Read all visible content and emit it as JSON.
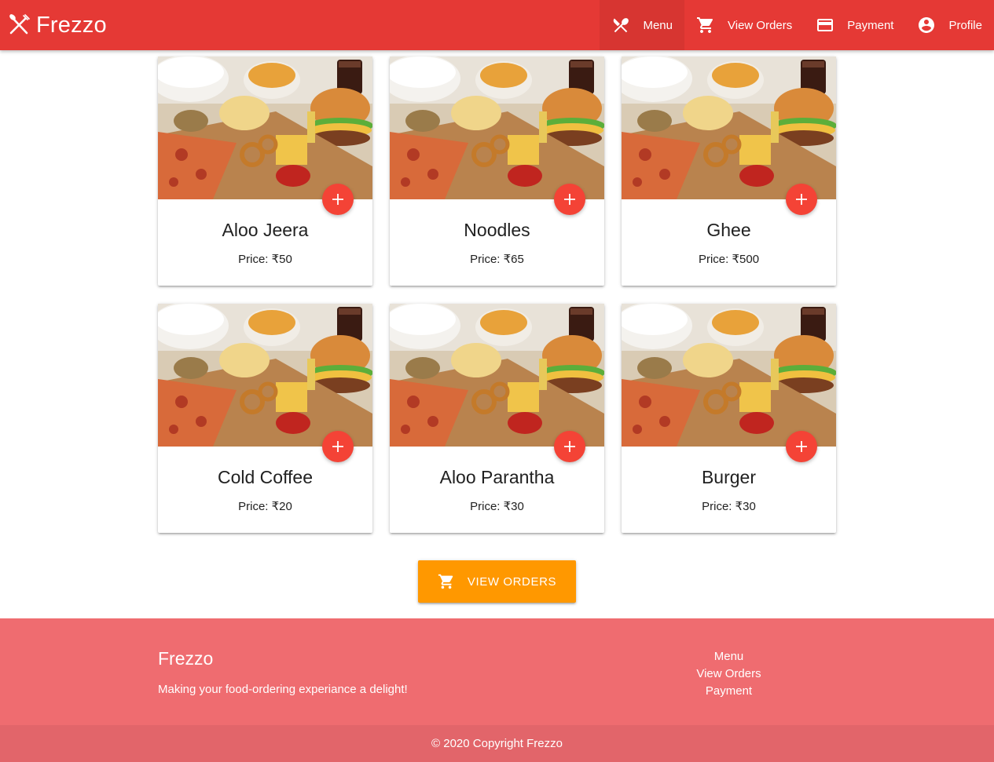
{
  "navbar": {
    "brand": "Frezzo",
    "items": [
      {
        "label": "Menu",
        "icon": "fork-knife-icon",
        "active": true
      },
      {
        "label": "View Orders",
        "icon": "cart-icon"
      },
      {
        "label": "Payment",
        "icon": "credit-card-icon"
      },
      {
        "label": "Profile",
        "icon": "account-circle-icon"
      }
    ]
  },
  "menu": {
    "items": [
      {
        "name": "Aloo Jeera",
        "price": "Price: ₹50"
      },
      {
        "name": "Noodles",
        "price": "Price: ₹65"
      },
      {
        "name": "Ghee",
        "price": "Price: ₹500"
      },
      {
        "name": "Cold Coffee",
        "price": "Price: ₹20"
      },
      {
        "name": "Aloo Parantha",
        "price": "Price: ₹30"
      },
      {
        "name": "Burger",
        "price": "Price: ₹30"
      }
    ]
  },
  "actions": {
    "view_orders_label": "VIEW ORDERS"
  },
  "footer": {
    "title": "Frezzo",
    "tagline": "Making your food-ordering experiance a delight!",
    "links": [
      "Menu",
      "View Orders",
      "Payment"
    ],
    "copyright": "© 2020 Copyright Frezzo"
  },
  "colors": {
    "primary": "#e53935",
    "fab": "#f44336",
    "accent": "#ff9800",
    "footer": "#ef6c70",
    "footer_bottom": "#e2656a"
  }
}
